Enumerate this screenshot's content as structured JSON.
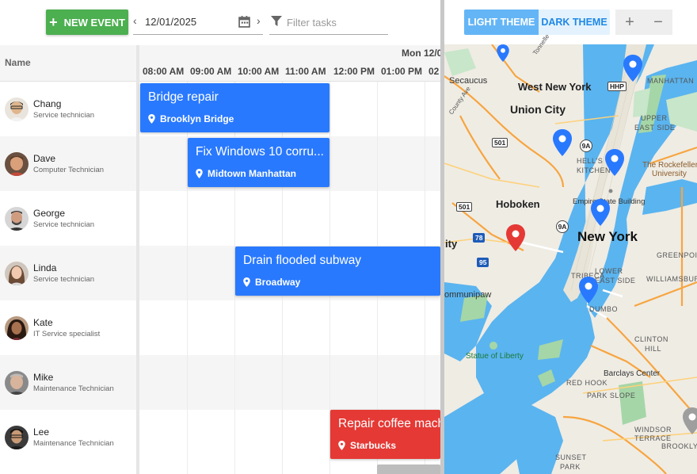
{
  "toolbar": {
    "new_event_label": "NEW EVENT",
    "date_value": "12/01/2025",
    "filter_placeholder": "Filter tasks"
  },
  "grid": {
    "name_header": "Name",
    "date_header": "Mon 12/0",
    "hours": [
      "08:00 AM",
      "09:00 AM",
      "10:00 AM",
      "11:00 AM",
      "12:00 PM",
      "01:00 PM",
      "02"
    ]
  },
  "resources": [
    {
      "name": "Chang",
      "role": "Service technician"
    },
    {
      "name": "Dave",
      "role": "Computer Technician"
    },
    {
      "name": "George",
      "role": "Service technician"
    },
    {
      "name": "Linda",
      "role": "Service technician"
    },
    {
      "name": "Kate",
      "role": "IT Service specialist"
    },
    {
      "name": "Mike",
      "role": "Maintenance Technician"
    },
    {
      "name": "Lee",
      "role": "Maintenance Technician"
    }
  ],
  "events": [
    {
      "title": "Bridge repair",
      "location": "Brooklyn Bridge",
      "color": "#2979ff"
    },
    {
      "title": "Fix Windows 10 corru...",
      "location": "Midtown Manhattan",
      "color": "#2979ff"
    },
    {
      "title": "Drain flooded subway",
      "location": "Broadway",
      "color": "#2979ff"
    },
    {
      "title": "Repair coffee mach",
      "location": "Starbucks",
      "color": "#e53935"
    }
  ],
  "map": {
    "light_theme_label": "LIGHT THEME",
    "dark_theme_label": "DARK THEME",
    "zoom_in_label": "+",
    "zoom_out_label": "−",
    "labels": {
      "secaucus": "Secaucus",
      "west_new_york": "West New York",
      "union_city": "Union City",
      "hoboken": "Hoboken",
      "new_york": "New York",
      "manhattan": "MANHATTAN",
      "upper_east_side_1": "UPPER",
      "upper_east_side_2": "EAST SIDE",
      "hells_kitchen_1": "HELL'S",
      "hells_kitchen_2": "KITCHEN",
      "rockefeller_1": "The Rockefeller",
      "rockefeller_2": "University",
      "empire_state": "Empire State Building",
      "tribeca": "TRIBECA",
      "lower_1": "LOWER",
      "lower_2": "EAST SIDE",
      "greenpoint": "GREENPOIN",
      "williamsburg": "WILLIAMSBURG",
      "dumbo": "DUMBO",
      "clinton_1": "CLINTON",
      "clinton_2": "HILL",
      "statue": "Statue of Liberty",
      "barclays": "Barclays Center",
      "red_hook": "RED HOOK",
      "park_slope": "PARK SLOPE",
      "windsor_1": "WINDSOR",
      "windsor_2": "TERRACE",
      "sunset_1": "SUNSET",
      "sunset_2": "PARK",
      "brooklyn": "BROOKLY",
      "ity": "ity",
      "ommunipaw": "ommunipaw",
      "county_ave": "County Ave",
      "tonnelle": "Tonnelle",
      "hhp": "HHP",
      "r501a": "501",
      "r501b": "501",
      "r9a_1": "9A",
      "r9a_2": "9A",
      "r78": "78",
      "r95": "95"
    }
  }
}
